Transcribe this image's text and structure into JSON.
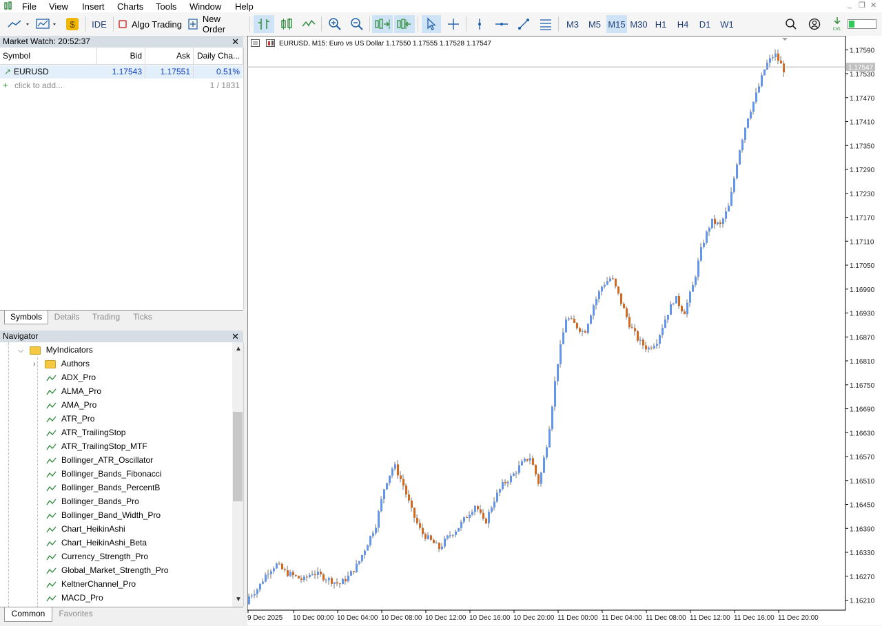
{
  "menubar": {
    "items": [
      "File",
      "View",
      "Insert",
      "Charts",
      "Tools",
      "Window",
      "Help"
    ]
  },
  "toolbar": {
    "ide_label": "IDE",
    "algo_trading_label": "Algo Trading",
    "new_order_label": "New Order",
    "timeframes": [
      "M3",
      "M5",
      "M15",
      "M30",
      "H1",
      "H4",
      "D1",
      "W1"
    ],
    "active_timeframe": "M15"
  },
  "market_watch": {
    "title": "Market Watch: 20:52:37",
    "columns": [
      "Symbol",
      "Bid",
      "Ask",
      "Daily Cha..."
    ],
    "rows": [
      {
        "symbol": "EURUSD",
        "bid": "1.17543",
        "ask": "1.17551",
        "change": "0.51%"
      }
    ],
    "add_label": "click to add...",
    "count_label": "1 / 1831",
    "tabs": [
      "Symbols",
      "Details",
      "Trading",
      "Ticks"
    ],
    "active_tab": "Symbols"
  },
  "navigator": {
    "title": "Navigator",
    "root_folder": "MyIndicators",
    "subfolder": "Authors",
    "items": [
      "ADX_Pro",
      "ALMA_Pro",
      "AMA_Pro",
      "ATR_Pro",
      "ATR_TrailingStop",
      "ATR_TrailingStop_MTF",
      "Bollinger_ATR_Oscillator",
      "Bollinger_Bands_Fibonacci",
      "Bollinger_Bands_PercentB",
      "Bollinger_Bands_Pro",
      "Bollinger_Band_Width_Pro",
      "Chart_HeikinAshi",
      "Chart_HeikinAshi_Beta",
      "Currency_Strength_Pro",
      "Global_Market_Strength_Pro",
      "KeltnerChannel_Pro",
      "MACD_Pro"
    ],
    "tabs": [
      "Common",
      "Favorites"
    ],
    "active_tab": "Common"
  },
  "chart": {
    "header": "EURUSD, M15:  Euro vs US Dollar  1.17550 1.17555 1.17528 1.17547",
    "current_price": "1.17547",
    "colors": {
      "bull": "#6495ed",
      "bear": "#d2691e",
      "wick": "#333333",
      "grid": "#ffffff"
    }
  },
  "chart_data": {
    "type": "candlestick",
    "symbol": "EURUSD",
    "timeframe": "M15",
    "y_ticks": [
      "1.17590",
      "1.17530",
      "1.17470",
      "1.17410",
      "1.17350",
      "1.17290",
      "1.17230",
      "1.17170",
      "1.17110",
      "1.17050",
      "1.16990",
      "1.16930",
      "1.16870",
      "1.16810",
      "1.16750",
      "1.16690",
      "1.16630",
      "1.16570",
      "1.16510",
      "1.16450",
      "1.16390",
      "1.16330",
      "1.16270",
      "1.16210"
    ],
    "x_ticks": [
      "9 Dec 2025",
      "10 Dec 00:00",
      "10 Dec 04:00",
      "10 Dec 08:00",
      "10 Dec 12:00",
      "10 Dec 16:00",
      "10 Dec 20:00",
      "11 Dec 00:00",
      "11 Dec 04:00",
      "11 Dec 08:00",
      "11 Dec 12:00",
      "11 Dec 16:00",
      "11 Dec 20:00"
    ],
    "ylim": [
      1.16185,
      1.17625
    ],
    "close_path": [
      1.1622,
      1.1624,
      1.1628,
      1.163,
      1.1628,
      1.1627,
      1.1626,
      1.1628,
      1.1627,
      1.1626,
      1.1625,
      1.1627,
      1.163,
      1.1635,
      1.164,
      1.165,
      1.1655,
      1.165,
      1.1643,
      1.1638,
      1.1636,
      1.1634,
      1.1637,
      1.1639,
      1.1642,
      1.1645,
      1.164,
      1.1646,
      1.165,
      1.1652,
      1.1655,
      1.1657,
      1.165,
      1.1662,
      1.168,
      1.1692,
      1.169,
      1.1688,
      1.1695,
      1.17,
      1.1702,
      1.1696,
      1.169,
      1.1686,
      1.1684,
      1.1686,
      1.1692,
      1.1697,
      1.1693,
      1.17,
      1.171,
      1.1716,
      1.1715,
      1.172,
      1.1733,
      1.1742,
      1.1748,
      1.1755,
      1.1758,
      1.1754
    ]
  }
}
